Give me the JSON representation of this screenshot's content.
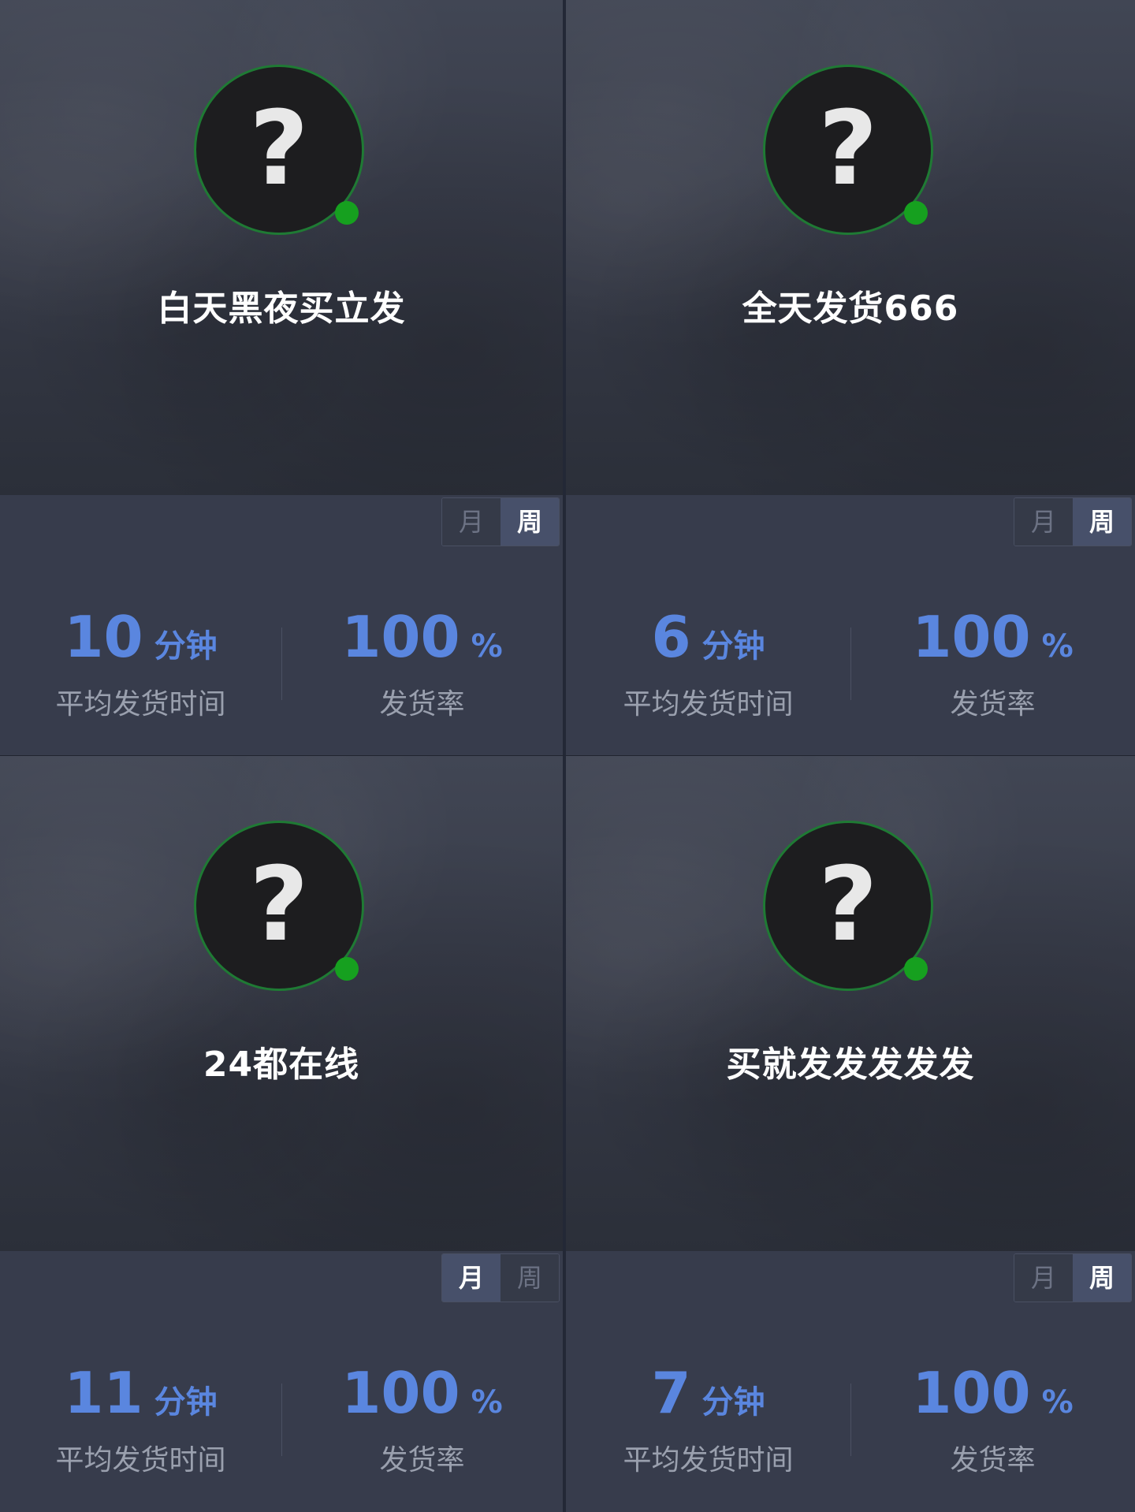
{
  "cards": [
    {
      "avatar_glyph": "?",
      "name": "白天黑夜买立发",
      "toggle": {
        "month": "月",
        "week": "周",
        "active": "week"
      },
      "avg_time": {
        "value": "10",
        "unit": "分钟",
        "label": "平均发货时间"
      },
      "ship_rate": {
        "value": "100",
        "unit": "%",
        "label": "发货率"
      }
    },
    {
      "avatar_glyph": "?",
      "name": "全天发货666",
      "toggle": {
        "month": "月",
        "week": "周",
        "active": "week"
      },
      "avg_time": {
        "value": "6",
        "unit": "分钟",
        "label": "平均发货时间"
      },
      "ship_rate": {
        "value": "100",
        "unit": "%",
        "label": "发货率"
      }
    },
    {
      "avatar_glyph": "?",
      "name": "24都在线",
      "toggle": {
        "month": "月",
        "week": "周",
        "active": "month"
      },
      "avg_time": {
        "value": "11",
        "unit": "分钟",
        "label": "平均发货时间"
      },
      "ship_rate": {
        "value": "100",
        "unit": "%",
        "label": "发货率"
      }
    },
    {
      "avatar_glyph": "?",
      "name": "买就发发发发发",
      "toggle": {
        "month": "月",
        "week": "周",
        "active": "week"
      },
      "avg_time": {
        "value": "7",
        "unit": "分钟",
        "label": "平均发货时间"
      },
      "ship_rate": {
        "value": "100",
        "unit": "%",
        "label": "发货率"
      }
    }
  ],
  "colors": {
    "accent_blue": "#5a86df",
    "online_green": "#16a01f",
    "avatar_ring": "#1f7a34"
  },
  "icons": {
    "avatar": "question-mark-avatar-icon",
    "status": "online-status-dot-icon"
  }
}
